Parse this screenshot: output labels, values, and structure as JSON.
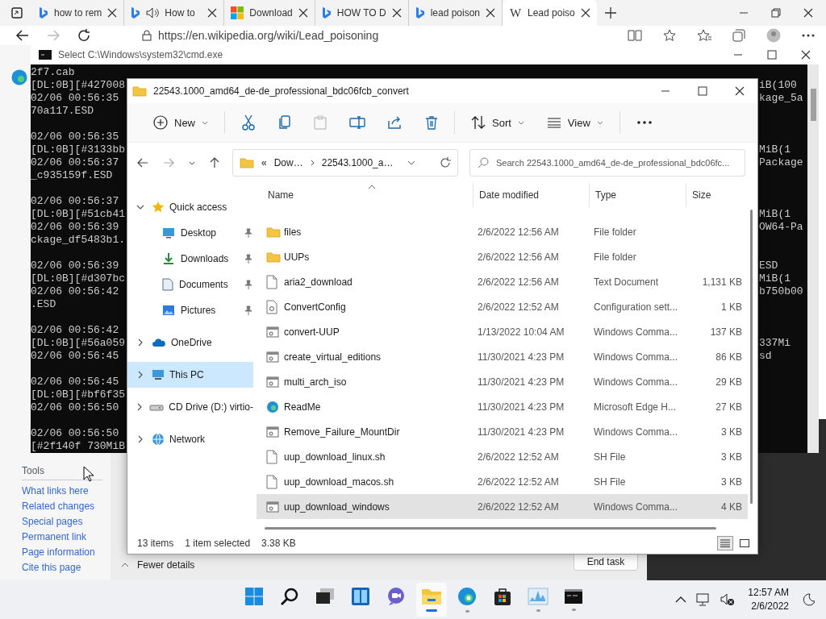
{
  "browser": {
    "tabs": [
      {
        "kind": "bing",
        "title": "how to rem",
        "audio": false,
        "selected": false
      },
      {
        "kind": "bing",
        "title": "How to",
        "audio": true,
        "selected": false
      },
      {
        "kind": "windows",
        "title": "Download",
        "audio": false,
        "selected": false
      },
      {
        "kind": "bing",
        "title": "HOW TO D",
        "audio": false,
        "selected": false
      },
      {
        "kind": "bing",
        "title": "lead poison",
        "audio": false,
        "selected": false
      },
      {
        "kind": "wiki",
        "glyph": "W",
        "title": "Lead poiso",
        "audio": false,
        "selected": true
      }
    ],
    "address": "https://en.wikipedia.org/wiki/Lead_poisoning",
    "sidebar": {
      "heading": "Tools",
      "links": [
        "What links here",
        "Related changes",
        "Special pages",
        "Permanent link",
        "Page information",
        "Cite this page"
      ]
    }
  },
  "cmd": {
    "title": "Select C:\\Windows\\system32\\cmd.exe",
    "lines": [
      {
        "left": "2f7.cab"
      },
      {
        "left": "[DL:0B][#427008",
        "right": "iB(100"
      },
      {
        "left": "02/06 00:56:35",
        "right": "kage_5a"
      },
      {
        "left": "70a117.ESD"
      },
      {
        "left": "02/06 00:56:35",
        "blank_before": true
      },
      {
        "left": "[DL:0B][#3133bb",
        "right": "MiB(1"
      },
      {
        "left": "02/06 00:56:37",
        "right": "Package"
      },
      {
        "left": "_c935159f.ESD"
      },
      {
        "left": "02/06 00:56:37",
        "blank_before": true
      },
      {
        "left": "[DL:0B][#51cb41",
        "right": "MiB(1"
      },
      {
        "left": "02/06 00:56:39",
        "right": "OW64-Pa"
      },
      {
        "left": "ckage_df5483b1."
      },
      {
        "left": "02/06 00:56:39",
        "right": "ESD",
        "blank_before": true
      },
      {
        "left": "[DL:0B][#d307bc",
        "right": "MiB(1"
      },
      {
        "left": "02/06 00:56:42",
        "right": "b750b00"
      },
      {
        "left": ".ESD"
      },
      {
        "left": "02/06 00:56:42",
        "blank_before": true
      },
      {
        "left": "[DL:0B][#56a059",
        "right": "337Mi"
      },
      {
        "left": "02/06 00:56:45",
        "right": "sd"
      },
      {
        "left": "02/06 00:56:45",
        "blank_before": true
      },
      {
        "left": "[DL:0B][#bf6f35"
      },
      {
        "left": "02/06 00:56:50"
      },
      {
        "left": "02/06 00:56:50",
        "blank_before": true
      },
      {
        "left": "[#2f140f 730MiB"
      }
    ]
  },
  "explorer": {
    "title": "22543.1000_amd64_de-de_professional_bdc06fcb_convert",
    "toolbar": [
      {
        "kind": "new",
        "label": "New",
        "disabled": false
      },
      {
        "kind": "cut",
        "disabled": false
      },
      {
        "kind": "copy",
        "disabled": false
      },
      {
        "kind": "paste",
        "disabled": true
      },
      {
        "kind": "rename",
        "disabled": false
      },
      {
        "kind": "share",
        "disabled": false
      },
      {
        "kind": "delete",
        "disabled": false
      },
      {
        "kind": "sort",
        "label": "Sort",
        "disabled": false
      },
      {
        "kind": "view",
        "label": "View",
        "disabled": false
      },
      {
        "kind": "more",
        "disabled": false
      }
    ],
    "breadcrumb": {
      "overflow": "«",
      "segments": [
        "Dow…",
        "22543.1000_a…"
      ]
    },
    "search": {
      "placeholder": "Search 22543.1000_amd64_de-de_professional_bdc06fc..."
    },
    "nav": [
      {
        "kind": "star",
        "label": "Quick access",
        "expanded": true,
        "selected": false,
        "children": [
          {
            "kind": "desktop",
            "label": "Desktop",
            "pinned": true,
            "selected": false
          },
          {
            "kind": "downloads",
            "label": "Downloads",
            "pinned": true,
            "selected": false
          },
          {
            "kind": "documents",
            "label": "Documents",
            "pinned": true,
            "selected": false
          },
          {
            "kind": "pictures",
            "label": "Pictures",
            "pinned": true,
            "selected": false
          }
        ]
      },
      {
        "kind": "cloud",
        "label": "OneDrive",
        "expanded": false,
        "selected": false
      },
      {
        "kind": "pc",
        "label": "This PC",
        "expanded": false,
        "selected": true
      },
      {
        "kind": "disc",
        "label": "CD Drive (D:) virtio-",
        "expanded": false,
        "selected": false
      },
      {
        "kind": "network",
        "label": "Network",
        "expanded": false,
        "selected": false
      }
    ],
    "columns": [
      "Name",
      "Date modified",
      "Type",
      "Size"
    ],
    "files": [
      {
        "kind": "folder",
        "name": "files",
        "date": "2/6/2022 12:56 AM",
        "type": "File folder",
        "selected": false
      },
      {
        "kind": "folder",
        "name": "UUPs",
        "date": "2/6/2022 12:56 AM",
        "type": "File folder",
        "selected": false
      },
      {
        "kind": "text",
        "name": "aria2_download",
        "date": "2/6/2022 12:56 AM",
        "type": "Text Document",
        "size": "1,131 KB",
        "selected": false
      },
      {
        "kind": "config",
        "name": "ConvertConfig",
        "date": "2/6/2022 12:52 AM",
        "type": "Configuration sett...",
        "size": "1 KB",
        "selected": false
      },
      {
        "kind": "script",
        "name": "convert-UUP",
        "date": "1/13/2022 10:04 AM",
        "type": "Windows Comma...",
        "size": "137 KB",
        "selected": false
      },
      {
        "kind": "script",
        "name": "create_virtual_editions",
        "date": "11/30/2021 4:23 PM",
        "type": "Windows Comma...",
        "size": "86 KB",
        "selected": false
      },
      {
        "kind": "script",
        "name": "multi_arch_iso",
        "date": "11/30/2021 4:23 PM",
        "type": "Windows Comma...",
        "size": "29 KB",
        "selected": false
      },
      {
        "kind": "edge",
        "name": "ReadMe",
        "date": "11/30/2021 4:23 PM",
        "type": "Microsoft Edge H...",
        "size": "27 KB",
        "selected": false
      },
      {
        "kind": "script",
        "name": "Remove_Failure_MountDir",
        "date": "11/30/2021 4:23 PM",
        "type": "Windows Comma...",
        "size": "3 KB",
        "selected": false
      },
      {
        "kind": "text",
        "name": "uup_download_linux.sh",
        "date": "2/6/2022 12:52 AM",
        "type": "SH File",
        "size": "3 KB",
        "selected": false
      },
      {
        "kind": "text",
        "name": "uup_download_macos.sh",
        "date": "2/6/2022 12:52 AM",
        "type": "SH File",
        "size": "3 KB",
        "selected": false
      },
      {
        "kind": "script",
        "name": "uup_download_windows",
        "date": "2/6/2022 12:52 AM",
        "type": "Windows Comma...",
        "size": "4 KB",
        "selected": true
      }
    ],
    "status": {
      "count": "13 items",
      "selection": "1 item selected",
      "size": "3.38 KB"
    },
    "views": [
      {
        "kind": "details",
        "selected": true
      },
      {
        "kind": "tiles",
        "selected": false
      }
    ]
  },
  "task_manager": {
    "toggle": "Fewer details",
    "end_task": "End task"
  },
  "taskbar": {
    "apps": [
      {
        "kind": "start",
        "running": false,
        "active": false
      },
      {
        "kind": "search",
        "running": false,
        "active": false
      },
      {
        "kind": "taskview",
        "running": false,
        "active": false
      },
      {
        "kind": "widgets",
        "running": false,
        "active": false
      },
      {
        "kind": "chat",
        "running": false,
        "active": false
      },
      {
        "kind": "explorer",
        "running": true,
        "active": true
      },
      {
        "kind": "edge",
        "running": true,
        "active": false
      },
      {
        "kind": "store",
        "running": false,
        "active": false
      },
      {
        "kind": "monitor",
        "running": true,
        "active": false
      },
      {
        "kind": "terminal",
        "running": true,
        "active": false
      }
    ],
    "time": "12:57 AM",
    "date": "2/6/2022"
  }
}
